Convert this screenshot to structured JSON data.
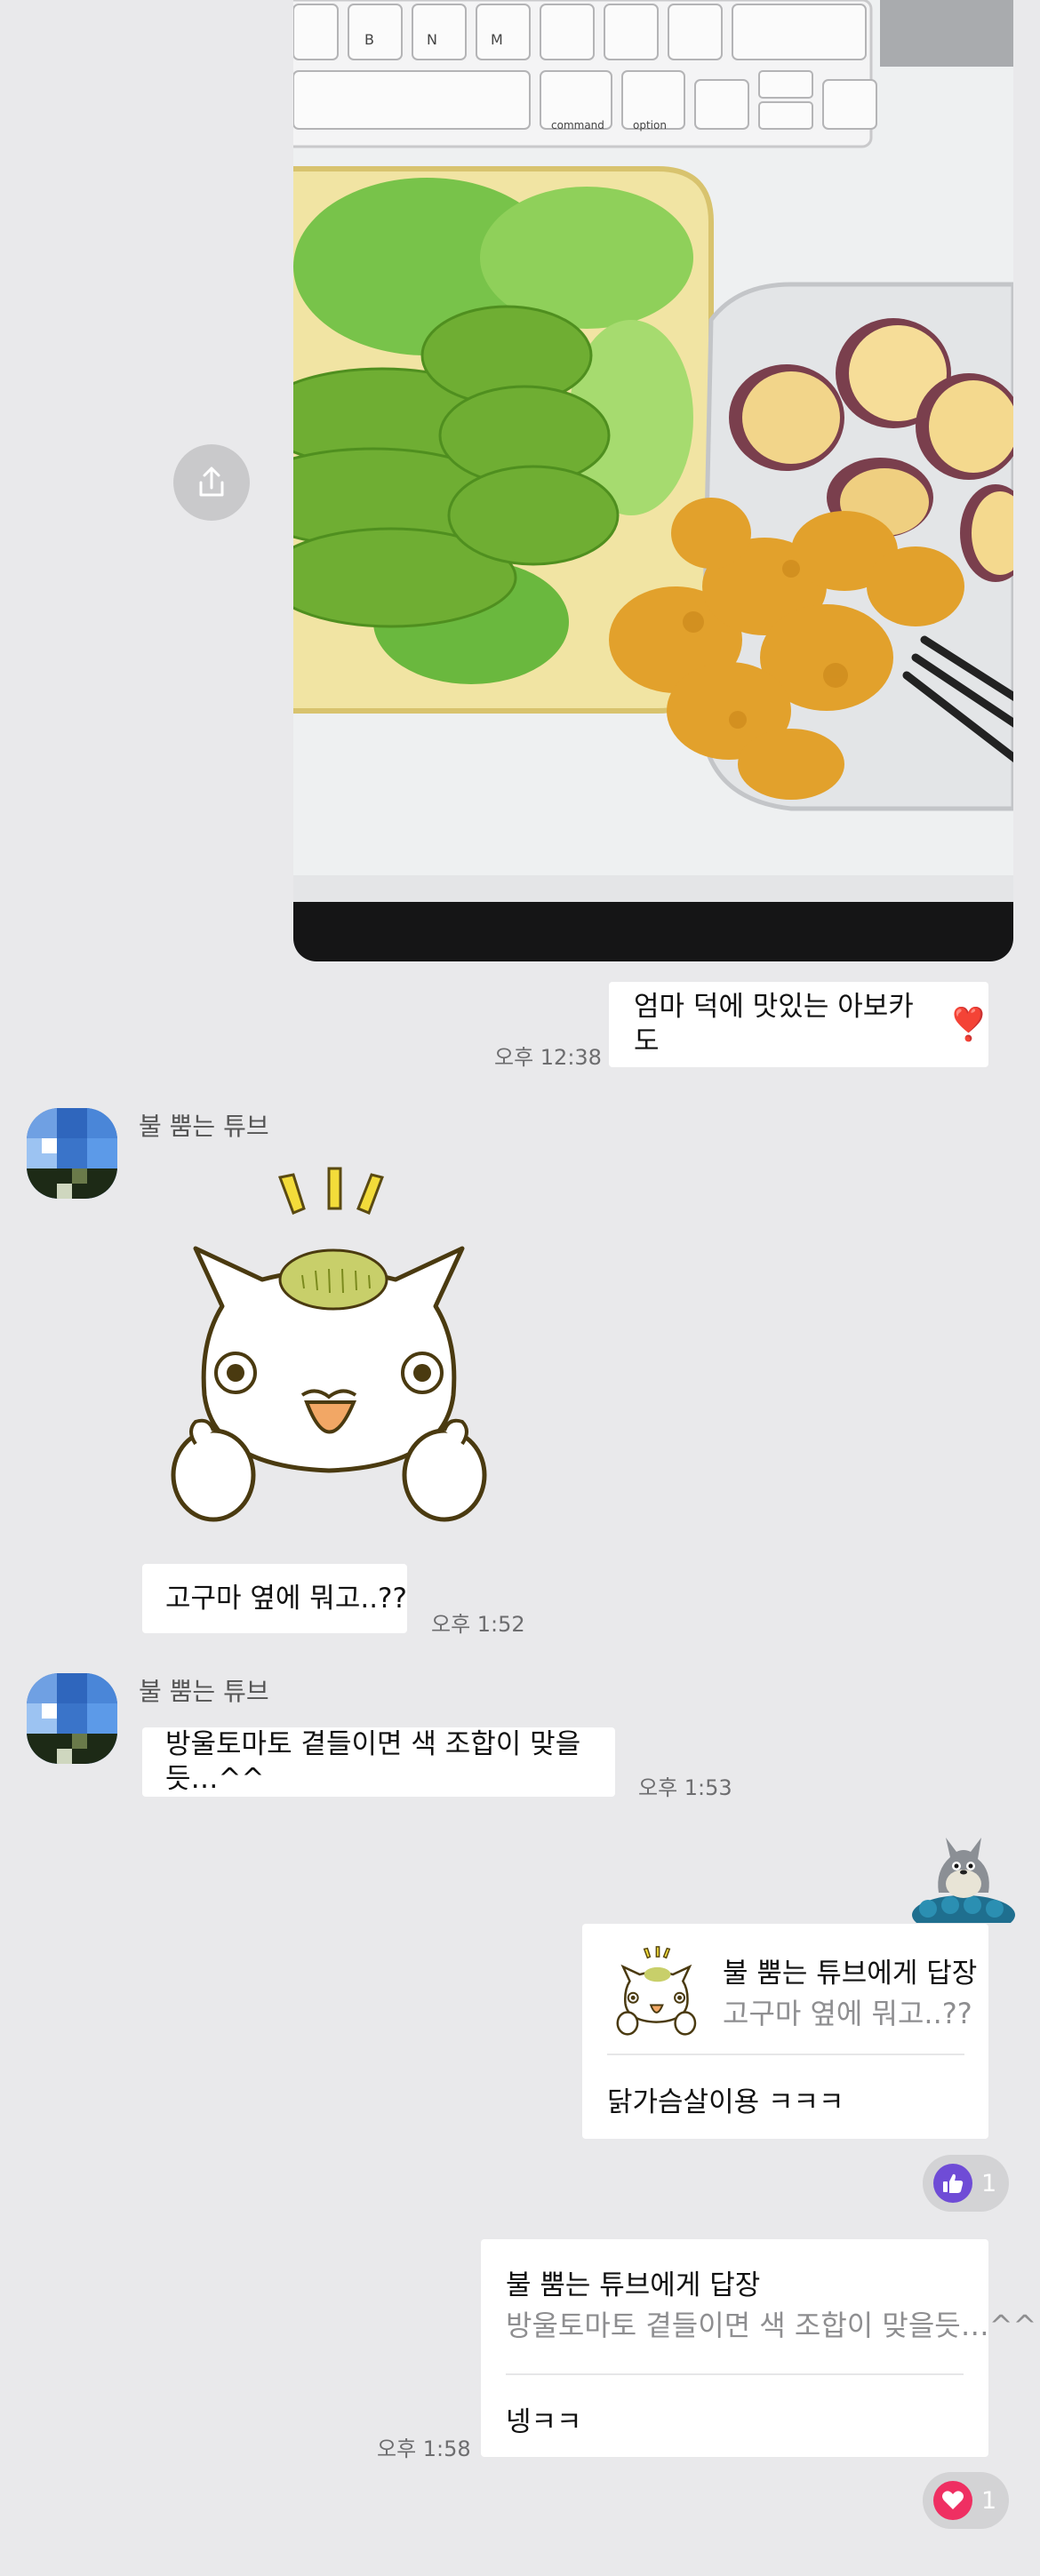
{
  "messages": {
    "m1": {
      "text": "엄마 덕에 맛있는 아보카도",
      "emoji": "❣️",
      "time": "오후 12:38"
    },
    "m2": {
      "sender": "불 뿜는 튜브",
      "text": "고구마 옆에 뭐고..??",
      "time": "오후 1:52"
    },
    "m3": {
      "sender": "불 뿜는 튜브",
      "text": "방울토마토 곁들이면 색 조합이 맞을듯…^^",
      "time": "오후 1:53"
    },
    "r1": {
      "title": "불 뿜는 튜브에게 답장",
      "quote": "고구마 옆에 뭐고..??",
      "message": "닭가슴살이용 ㅋㅋㅋ",
      "reaction_count": "1",
      "reaction_icon": "thumbs-up-icon"
    },
    "r2": {
      "title": "불 뿜는 튜브에게 답장",
      "quote": "방울토마토 곁들이면 색 조합이 맞을듯…^^",
      "message": "넹ㅋㅋ",
      "time": "오후 1:58",
      "reaction_count": "1",
      "reaction_icon": "heart-icon"
    }
  },
  "colors": {
    "background": "#e9e9eb",
    "bubble": "#ffffff",
    "like": "#6f4cd6",
    "heart": "#ef2f62"
  }
}
